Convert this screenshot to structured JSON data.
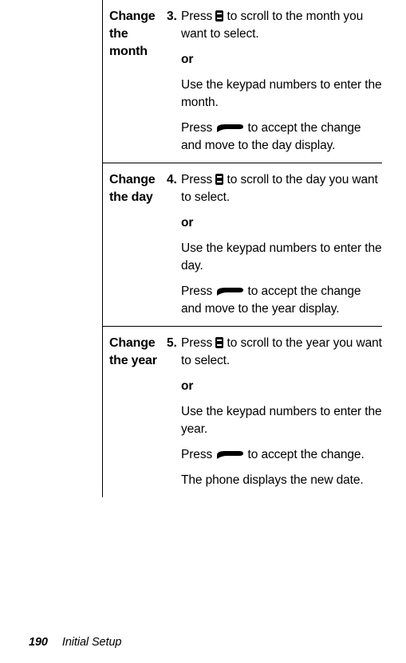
{
  "rows": [
    {
      "label": "Change the month",
      "num": "3.",
      "line1a": "Press ",
      "line1b": " to scroll to the month you want to select.",
      "or": "or",
      "line2": "Use the keypad numbers to enter the month.",
      "line3a": "Press ",
      "line3b": " to accept the change and move to the day display."
    },
    {
      "label": "Change the day",
      "num": "4.",
      "line1a": "Press ",
      "line1b": " to scroll to the day you want to select.",
      "or": "or",
      "line2": "Use the keypad numbers to enter the day.",
      "line3a": "Press ",
      "line3b": " to accept the change and move to the year display."
    },
    {
      "label": "Change the year",
      "num": "5.",
      "line1a": "Press ",
      "line1b": " to scroll to the year you want to select.",
      "or": "or",
      "line2": "Use the keypad numbers to enter the year.",
      "line3a": "Press ",
      "line3b": " to accept the change.",
      "line4": "The phone displays the new date."
    }
  ],
  "footer": {
    "page": "190",
    "section": "Initial Setup"
  }
}
